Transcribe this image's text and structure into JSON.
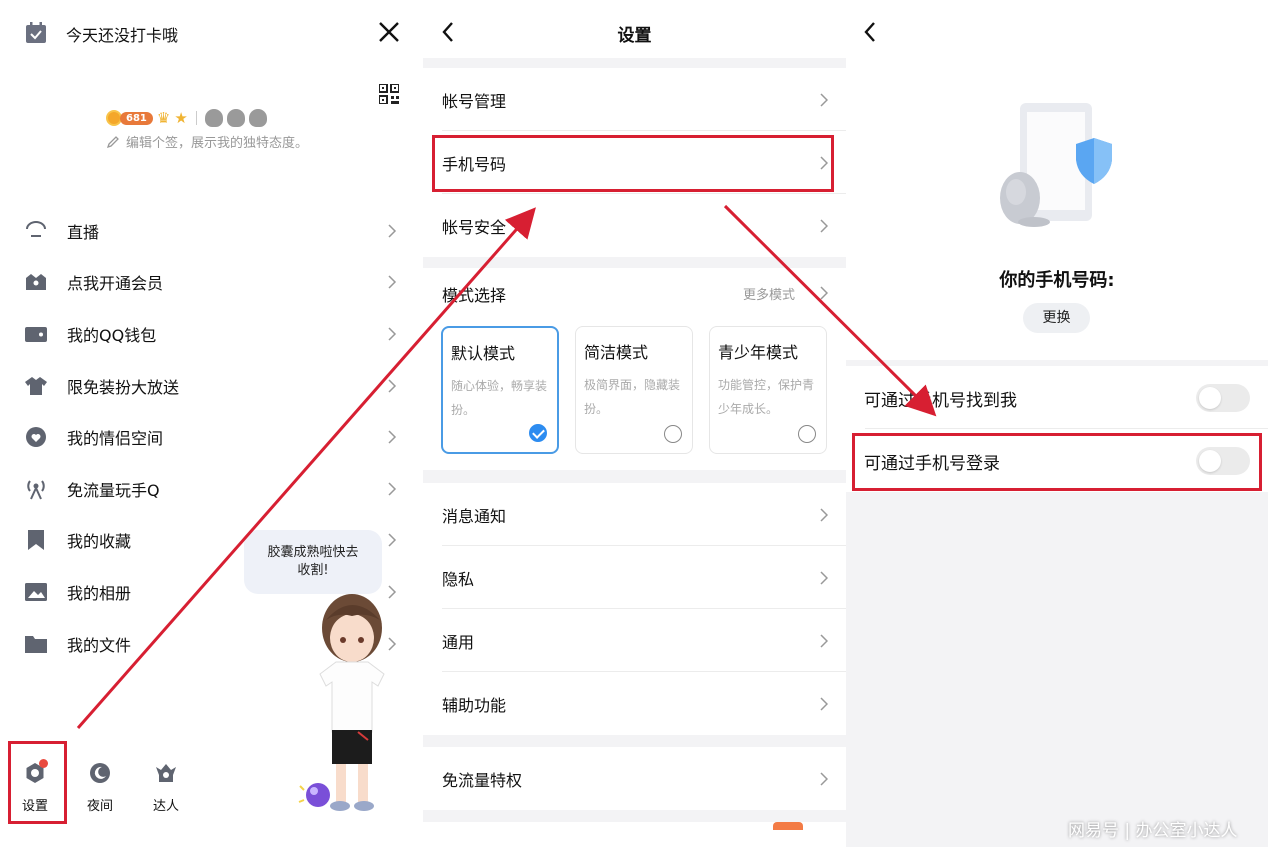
{
  "drawer": {
    "checkin_text": "今天还没打卡哦",
    "level_number": "681",
    "signature": "编辑个签，展示我的独特态度。",
    "menu": [
      {
        "icon": "live-icon",
        "label": "直播"
      },
      {
        "icon": "vip-icon",
        "label": "点我开通会员"
      },
      {
        "icon": "wallet-icon",
        "label": "我的QQ钱包"
      },
      {
        "icon": "outfit-icon",
        "label": "限免装扮大放送"
      },
      {
        "icon": "couple-icon",
        "label": "我的情侣空间"
      },
      {
        "icon": "free-data-icon",
        "label": "免流量玩手Q"
      },
      {
        "icon": "bookmark-icon",
        "label": "我的收藏"
      },
      {
        "icon": "album-icon",
        "label": "我的相册"
      },
      {
        "icon": "folder-icon",
        "label": "我的文件"
      }
    ],
    "bubble_text_line1": "胶囊成熟啦快去",
    "bubble_text_line2": "收割!",
    "bottom": {
      "settings": "设置",
      "night": "夜间",
      "expert": "达人"
    }
  },
  "settings": {
    "title": "设置",
    "account_group": [
      "帐号管理",
      "手机号码",
      "帐号安全"
    ],
    "mode": {
      "heading": "模式选择",
      "more": "更多模式",
      "cards": [
        {
          "title": "默认模式",
          "desc": "随心体验，畅享装扮。",
          "selected": true
        },
        {
          "title": "简洁模式",
          "desc": "极简界面，隐藏装扮。",
          "selected": false
        },
        {
          "title": "青少年模式",
          "desc": "功能管控，保护青少年成长。",
          "selected": false
        }
      ]
    },
    "general_group": [
      "消息通知",
      "隐私",
      "通用",
      "辅助功能"
    ],
    "free_data": "免流量特权"
  },
  "phone": {
    "label": "你的手机号码:",
    "change_button": "更换",
    "toggles": [
      {
        "label": "可通过手机号找到我",
        "on": false
      },
      {
        "label": "可通过手机号登录",
        "on": false
      }
    ],
    "watermark": "网易号 | 办公室小达人"
  },
  "colors": {
    "highlight": "#d71f32",
    "accent_blue": "#2d8cf0",
    "badge_orange": "#e8793a"
  }
}
